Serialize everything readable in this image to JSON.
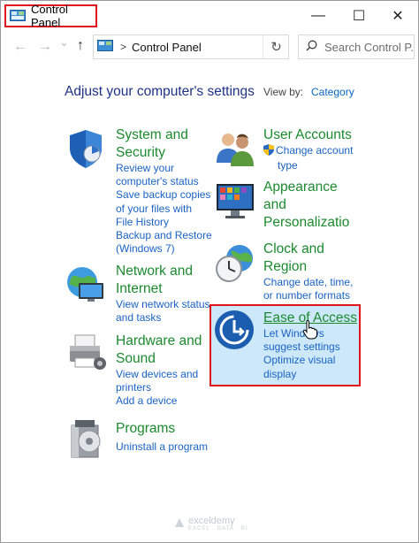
{
  "window": {
    "title": "Control Panel",
    "minimize_glyph": "—",
    "maximize_glyph": "☐",
    "close_glyph": "✕"
  },
  "nav": {
    "back_glyph": "←",
    "forward_glyph": "→",
    "recent_glyph": "⌄",
    "up_glyph": "↑",
    "breadcrumb": "Control Panel",
    "breadcrumb_sep": ">",
    "refresh_glyph": "↻",
    "search_placeholder": "Search Control P...",
    "search_icon": "search-icon"
  },
  "main": {
    "heading": "Adjust your computer's settings",
    "view_by_label": "View by:",
    "view_by_value": "Category"
  },
  "categories": {
    "system_security": {
      "title_line1": "System and",
      "title_line2": "Security",
      "links": [
        "Review your computer's status",
        "Save backup copies of your files with File History",
        "Backup and Restore (Windows 7)"
      ],
      "link_lines": [
        "Review your",
        "computer's status",
        "Save backup copies",
        "of your files with",
        "File History",
        "Backup and Restore",
        "(Windows 7)"
      ]
    },
    "network": {
      "title_line1": "Network and",
      "title_line2": "Internet",
      "link_lines": [
        "View network status",
        "and tasks"
      ]
    },
    "hardware": {
      "title_line1": "Hardware and",
      "title_line2": "Sound",
      "link_lines": [
        "View devices and",
        "printers",
        "Add a device"
      ]
    },
    "programs": {
      "title_line1": "Programs",
      "link_lines": [
        "Uninstall a program"
      ]
    },
    "user_accounts": {
      "title_line1": "User Accounts",
      "link_lines": [
        "Change account",
        "type"
      ]
    },
    "appearance": {
      "title_line1": "Appearance",
      "title_line2": "and",
      "title_line3": "Personalizatio"
    },
    "clock": {
      "title_line1": "Clock and",
      "title_line2": "Region",
      "link_lines": [
        "Change date, time,",
        "or number formats"
      ]
    },
    "ease": {
      "title_line1": "Ease of Access",
      "link_lines": [
        "Let Windows",
        "suggest settings",
        "Optimize visual",
        "display"
      ]
    }
  },
  "watermark": {
    "name": "exceldemy",
    "tagline": "EXCEL · DATA · BI"
  },
  "colors": {
    "highlight_border": "#e0151c",
    "category_title": "#1b8a2e",
    "link": "#1a63c4",
    "heading": "#1e3287",
    "ease_highlight_bg": "#cde8fb"
  }
}
